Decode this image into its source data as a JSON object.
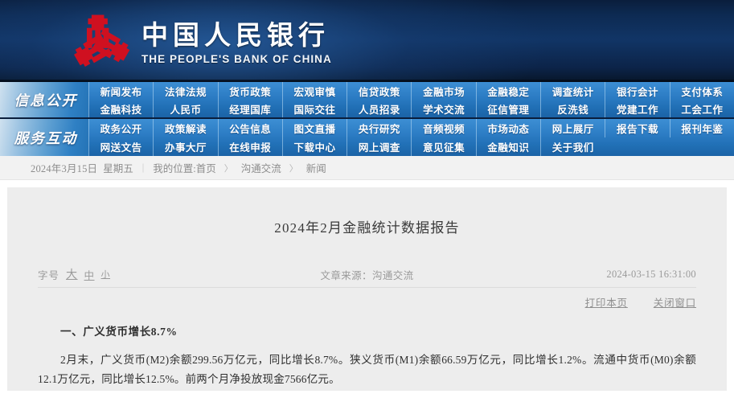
{
  "header": {
    "logo_icon": "pbc-emblem-icon",
    "brand_cn": "中国人民银行",
    "brand_en": "THE PEOPLE'S BANK OF CHINA"
  },
  "nav": {
    "blocks": [
      {
        "side_label": "信息公开",
        "rows": [
          [
            "新闻发布",
            "法律法规",
            "货币政策",
            "宏观审慎",
            "信贷政策",
            "金融市场",
            "金融稳定",
            "调查统计",
            "银行会计",
            "支付体系"
          ],
          [
            "金融科技",
            "人民币",
            "经理国库",
            "国际交往",
            "人员招录",
            "学术交流",
            "征信管理",
            "反洗钱",
            "党建工作",
            "工会工作"
          ]
        ]
      },
      {
        "side_label": "服务互动",
        "rows": [
          [
            "政务公开",
            "政策解读",
            "公告信息",
            "图文直播",
            "央行研究",
            "音频视频",
            "市场动态",
            "网上展厅",
            "报告下载",
            "报刊年鉴"
          ],
          [
            "网送文告",
            "办事大厅",
            "在线申报",
            "下载中心",
            "网上调查",
            "意见征集",
            "金融知识",
            "关于我们",
            "",
            ""
          ]
        ]
      }
    ]
  },
  "breadcrumb": {
    "date": "2024年3月15日",
    "weekday": "星期五",
    "divider": "|",
    "location_label": "我的位置:首页",
    "arrow": "〉",
    "item1": "沟通交流",
    "item2": "新闻"
  },
  "article": {
    "title": "2024年2月金融统计数据报告",
    "fontsize_label": "字号",
    "fontsize_large": "大",
    "fontsize_medium": "中",
    "fontsize_small": "小",
    "source": "文章来源：沟通交流",
    "datetime": "2024-03-15 16:31:00",
    "print_label": "打印本页",
    "close_label": "关闭窗口",
    "section_heading": "一、广义货币增长8.7%",
    "paragraph": "2月末，广义货币(M2)余额299.56万亿元，同比增长8.7%。狭义货币(M1)余额66.59万亿元，同比增长1.2%。流通中货币(M0)余额12.1万亿元，同比增长12.5%。前两个月净投放现金7566亿元。"
  },
  "colors": {
    "header_navy": "#0a1e3c",
    "nav_blue": "#2c7cc4",
    "logo_red": "#cf1020",
    "panel_gray": "#ededed",
    "crumb_gray": "#f2f2f2"
  }
}
